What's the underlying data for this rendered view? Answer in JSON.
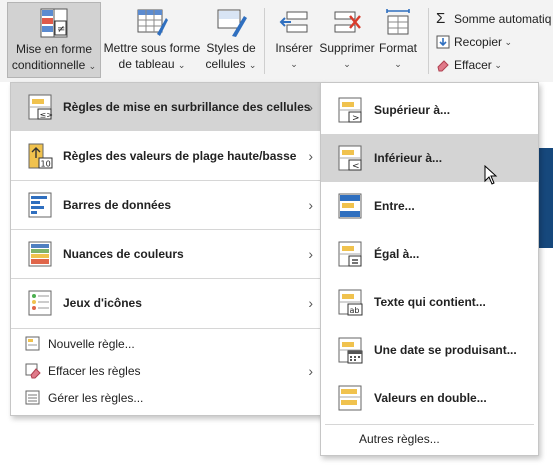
{
  "ribbon": {
    "buttons": [
      {
        "label1": "Mise en forme",
        "label2": "conditionnelle",
        "icon": "conditional-format-icon"
      },
      {
        "label1": "Mettre sous forme",
        "label2": "de tableau",
        "icon": "format-as-table-icon"
      },
      {
        "label1": "Styles de",
        "label2": "cellules",
        "icon": "cell-styles-icon"
      },
      {
        "label1": "Insérer",
        "label2": "",
        "icon": "insert-cells-icon"
      },
      {
        "label1": "Supprimer",
        "label2": "",
        "icon": "delete-cells-icon"
      },
      {
        "label1": "Format",
        "label2": "",
        "icon": "format-cells-icon"
      }
    ],
    "autosum": "Somme automatiq",
    "fill": "Recopier",
    "clear": "Effacer"
  },
  "menu1": {
    "items": [
      {
        "label": "Règles de mise en surbrillance des cellules",
        "icon": "highlight-cells-rules-icon"
      },
      {
        "label": "Règles des valeurs de plage haute/basse",
        "icon": "top-bottom-rules-icon"
      },
      {
        "label": "Barres de données",
        "icon": "data-bars-icon"
      },
      {
        "label": "Nuances de couleurs",
        "icon": "color-scales-icon"
      },
      {
        "label": "Jeux d'icônes",
        "icon": "icon-sets-icon"
      }
    ],
    "actions": [
      {
        "label": "Nouvelle règle...",
        "icon": "new-rule-icon"
      },
      {
        "label": "Effacer les règles",
        "icon": "clear-rules-icon"
      },
      {
        "label": "Gérer les règles...",
        "icon": "manage-rules-icon"
      }
    ]
  },
  "menu2": {
    "items": [
      {
        "label": "Supérieur à...",
        "icon": "greater-than-icon"
      },
      {
        "label": "Inférieur à...",
        "icon": "less-than-icon"
      },
      {
        "label": "Entre...",
        "icon": "between-icon"
      },
      {
        "label": "Égal à...",
        "icon": "equal-to-icon"
      },
      {
        "label": "Texte qui contient...",
        "icon": "text-contains-icon"
      },
      {
        "label": "Une date se produisant...",
        "icon": "date-occurring-icon"
      },
      {
        "label": "Valeurs en double...",
        "icon": "duplicate-values-icon"
      }
    ],
    "more": "Autres règles..."
  },
  "colors": {
    "highlight": "#d4d4d4",
    "accent_blue": "#2f5597",
    "gold": "#f0c24e"
  }
}
